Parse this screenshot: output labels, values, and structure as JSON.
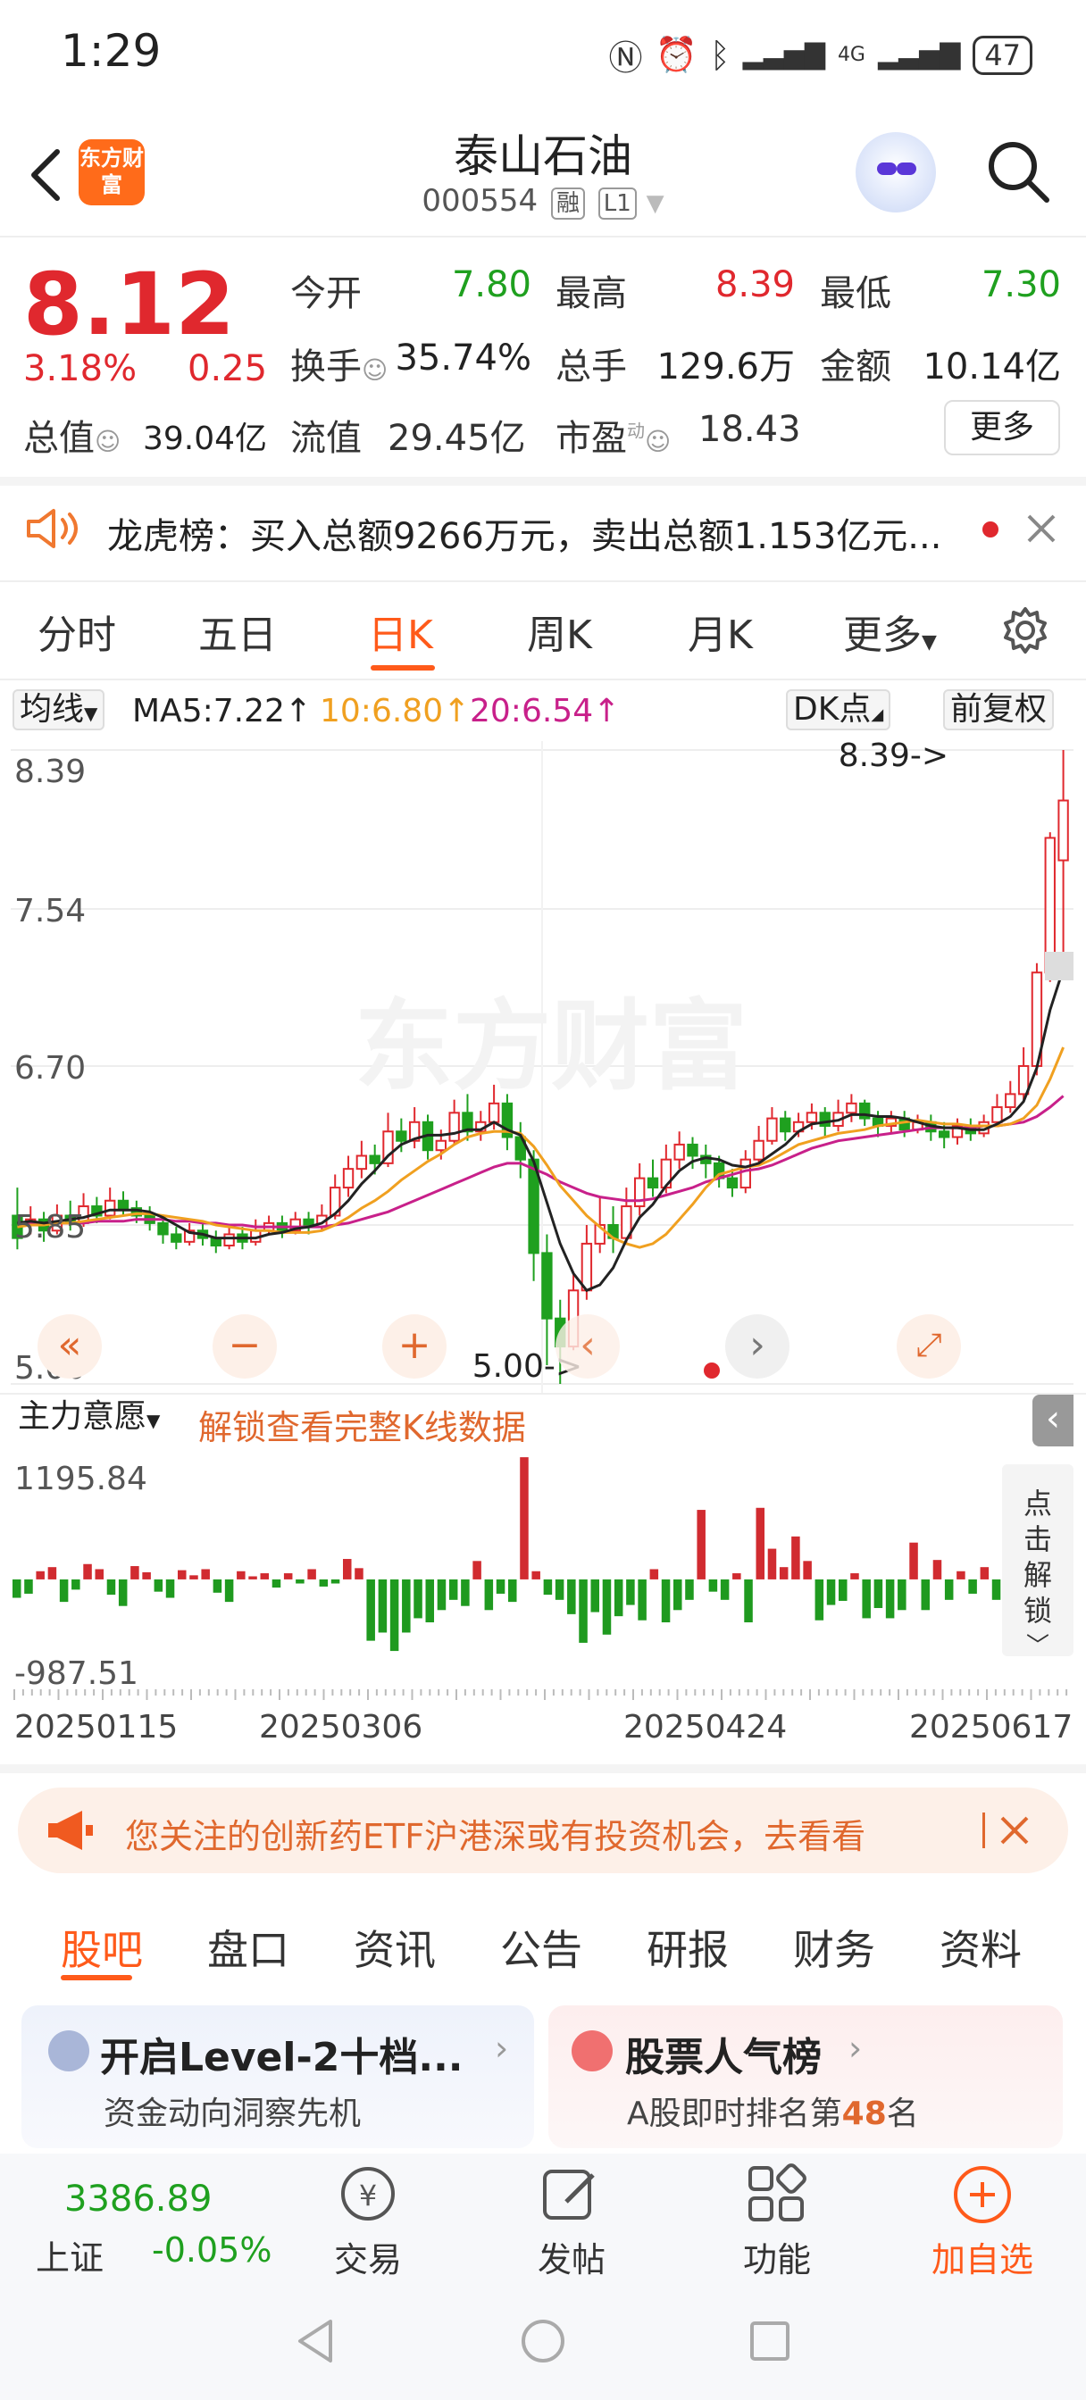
{
  "status_bar": {
    "time": "1:29",
    "network": "4G",
    "battery": "47"
  },
  "header": {
    "logo_text": "东方财富",
    "stock_name": "泰山石油",
    "stock_code": "000554",
    "tag_rong": "融",
    "tag_level": "L1"
  },
  "quote": {
    "price": "8.12",
    "change_pct": "3.18%",
    "change": "0.25",
    "rows": [
      [
        {
          "label": "今开",
          "value": "7.80",
          "color": "#1fa01f"
        },
        {
          "label": "最高",
          "value": "8.39",
          "color": "#e0282e"
        },
        {
          "label": "最低",
          "value": "7.30",
          "color": "#1fa01f"
        }
      ],
      [
        {
          "label": "换手",
          "value": "35.74%",
          "color": "#222"
        },
        {
          "label": "总手",
          "value": "129.6万",
          "color": "#222"
        },
        {
          "label": "金额",
          "value": "10.14亿",
          "color": "#222"
        }
      ]
    ],
    "row3": {
      "total_label": "总值",
      "total_value": "39.04亿",
      "float_label": "流值",
      "float_value": "29.45亿",
      "pe_label": "市盈",
      "pe_sup": "动",
      "pe_value": "18.43"
    },
    "more_label": "更多"
  },
  "notice": {
    "text": "龙虎榜：买入总额9266万元，卖出总额1.153亿元..."
  },
  "kline_tabs": [
    "分时",
    "五日",
    "日K",
    "周K",
    "月K",
    "更多"
  ],
  "kline_active": "日K",
  "ma_row": {
    "selector": "均线",
    "ma5": "MA5:7.22↑",
    "ma10": "10:6.80↑",
    "ma20": "20:6.54↑",
    "dk": "DK点",
    "adjust": "前复权"
  },
  "chart_data": {
    "type": "candlestick",
    "y_ticks": [
      "8.39",
      "7.54",
      "6.70",
      "5.85",
      "5.00"
    ],
    "ylim": [
      5.0,
      8.39
    ],
    "high_marker": "8.39->",
    "low_marker": "5.00->",
    "watermark": "东方财富",
    "candles": [
      [
        5.9,
        5.78,
        6.05,
        5.72
      ],
      [
        5.85,
        5.88,
        5.95,
        5.8
      ],
      [
        5.88,
        5.82,
        5.92,
        5.76
      ],
      [
        5.82,
        5.9,
        5.96,
        5.8
      ],
      [
        5.9,
        5.86,
        5.98,
        5.82
      ],
      [
        5.86,
        5.95,
        6.02,
        5.84
      ],
      [
        5.95,
        5.9,
        6.0,
        5.86
      ],
      [
        5.9,
        5.98,
        6.05,
        5.88
      ],
      [
        5.98,
        5.94,
        6.03,
        5.9
      ],
      [
        5.94,
        5.9,
        5.98,
        5.86
      ],
      [
        5.9,
        5.86,
        5.95,
        5.82
      ],
      [
        5.86,
        5.8,
        5.9,
        5.75
      ],
      [
        5.8,
        5.76,
        5.84,
        5.72
      ],
      [
        5.76,
        5.82,
        5.86,
        5.74
      ],
      [
        5.82,
        5.78,
        5.86,
        5.74
      ],
      [
        5.78,
        5.74,
        5.82,
        5.7
      ],
      [
        5.74,
        5.8,
        5.85,
        5.72
      ],
      [
        5.8,
        5.76,
        5.84,
        5.72
      ],
      [
        5.76,
        5.82,
        5.88,
        5.74
      ],
      [
        5.82,
        5.86,
        5.9,
        5.8
      ],
      [
        5.86,
        5.82,
        5.9,
        5.78
      ],
      [
        5.82,
        5.88,
        5.92,
        5.8
      ],
      [
        5.88,
        5.84,
        5.92,
        5.8
      ],
      [
        5.84,
        5.9,
        5.96,
        5.82
      ],
      [
        5.9,
        6.05,
        6.12,
        5.88
      ],
      [
        6.05,
        6.15,
        6.22,
        6.0
      ],
      [
        6.15,
        6.22,
        6.3,
        6.1
      ],
      [
        6.22,
        6.18,
        6.28,
        6.12
      ],
      [
        6.18,
        6.35,
        6.45,
        6.16
      ],
      [
        6.35,
        6.3,
        6.42,
        6.24
      ],
      [
        6.3,
        6.4,
        6.48,
        6.26
      ],
      [
        6.4,
        6.25,
        6.44,
        6.2
      ],
      [
        6.25,
        6.3,
        6.36,
        6.2
      ],
      [
        6.3,
        6.45,
        6.52,
        6.28
      ],
      [
        6.45,
        6.35,
        6.55,
        6.3
      ],
      [
        6.35,
        6.4,
        6.46,
        6.3
      ],
      [
        6.4,
        6.5,
        6.6,
        6.36
      ],
      [
        6.5,
        6.32,
        6.55,
        6.25
      ],
      [
        6.32,
        6.2,
        6.4,
        6.1
      ],
      [
        6.2,
        5.7,
        6.25,
        5.55
      ],
      [
        5.7,
        5.35,
        5.8,
        5.1
      ],
      [
        5.35,
        5.2,
        5.45,
        5.0
      ],
      [
        5.2,
        5.5,
        5.6,
        5.18
      ],
      [
        5.5,
        5.75,
        5.85,
        5.45
      ],
      [
        5.75,
        5.85,
        6.0,
        5.7
      ],
      [
        5.85,
        5.78,
        5.95,
        5.7
      ],
      [
        5.78,
        5.95,
        6.05,
        5.75
      ],
      [
        5.95,
        6.1,
        6.18,
        5.9
      ],
      [
        6.1,
        6.05,
        6.2,
        6.0
      ],
      [
        6.05,
        6.2,
        6.28,
        6.02
      ],
      [
        6.2,
        6.28,
        6.35,
        6.15
      ],
      [
        6.28,
        6.22,
        6.32,
        6.15
      ],
      [
        6.22,
        6.18,
        6.28,
        6.1
      ],
      [
        6.18,
        6.1,
        6.22,
        6.05
      ],
      [
        6.1,
        6.05,
        6.15,
        6.0
      ],
      [
        6.05,
        6.2,
        6.25,
        6.02
      ],
      [
        6.2,
        6.3,
        6.38,
        6.18
      ],
      [
        6.3,
        6.42,
        6.48,
        6.28
      ],
      [
        6.42,
        6.35,
        6.46,
        6.3
      ],
      [
        6.35,
        6.4,
        6.45,
        6.32
      ],
      [
        6.4,
        6.45,
        6.5,
        6.36
      ],
      [
        6.45,
        6.38,
        6.48,
        6.32
      ],
      [
        6.38,
        6.45,
        6.52,
        6.35
      ],
      [
        6.45,
        6.5,
        6.55,
        6.4
      ],
      [
        6.5,
        6.42,
        6.52,
        6.38
      ],
      [
        6.42,
        6.38,
        6.46,
        6.32
      ],
      [
        6.38,
        6.42,
        6.46,
        6.34
      ],
      [
        6.42,
        6.36,
        6.46,
        6.32
      ],
      [
        6.36,
        6.4,
        6.44,
        6.34
      ],
      [
        6.4,
        6.35,
        6.44,
        6.3
      ],
      [
        6.35,
        6.32,
        6.4,
        6.26
      ],
      [
        6.32,
        6.38,
        6.42,
        6.28
      ],
      [
        6.38,
        6.34,
        6.42,
        6.3
      ],
      [
        6.34,
        6.4,
        6.44,
        6.32
      ],
      [
        6.4,
        6.48,
        6.55,
        6.38
      ],
      [
        6.48,
        6.55,
        6.62,
        6.45
      ],
      [
        6.55,
        6.7,
        6.8,
        6.52
      ],
      [
        6.7,
        7.2,
        7.25,
        6.65
      ],
      [
        7.2,
        7.92,
        7.95,
        7.15
      ],
      [
        7.8,
        8.12,
        8.39,
        7.3
      ]
    ],
    "ma5": [
      5.86,
      5.87,
      5.86,
      5.87,
      5.88,
      5.89,
      5.91,
      5.93,
      5.93,
      5.93,
      5.92,
      5.89,
      5.85,
      5.81,
      5.8,
      5.78,
      5.78,
      5.78,
      5.78,
      5.8,
      5.81,
      5.83,
      5.84,
      5.86,
      5.91,
      5.98,
      6.07,
      6.14,
      6.22,
      6.28,
      6.31,
      6.33,
      6.33,
      6.34,
      6.36,
      6.36,
      6.4,
      6.36,
      6.33,
      6.19,
      5.97,
      5.75,
      5.59,
      5.5,
      5.53,
      5.62,
      5.77,
      5.89,
      5.96,
      6.06,
      6.14,
      6.19,
      6.21,
      6.2,
      6.17,
      6.16,
      6.18,
      6.23,
      6.28,
      6.35,
      6.39,
      6.4,
      6.41,
      6.44,
      6.44,
      6.43,
      6.43,
      6.42,
      6.4,
      6.38,
      6.37,
      6.37,
      6.36,
      6.36,
      6.39,
      6.43,
      6.51,
      6.69,
      7.0,
      7.22
    ],
    "ma10": [
      5.84,
      5.85,
      5.85,
      5.86,
      5.86,
      5.87,
      5.88,
      5.89,
      5.9,
      5.91,
      5.91,
      5.9,
      5.89,
      5.88,
      5.87,
      5.85,
      5.84,
      5.83,
      5.82,
      5.82,
      5.81,
      5.81,
      5.81,
      5.82,
      5.85,
      5.89,
      5.94,
      5.98,
      6.03,
      6.09,
      6.14,
      6.19,
      6.23,
      6.28,
      6.32,
      6.34,
      6.35,
      6.35,
      6.34,
      6.27,
      6.17,
      6.06,
      5.98,
      5.9,
      5.84,
      5.78,
      5.75,
      5.73,
      5.75,
      5.8,
      5.88,
      5.96,
      6.05,
      6.12,
      6.14,
      6.16,
      6.17,
      6.2,
      6.24,
      6.28,
      6.3,
      6.32,
      6.34,
      6.35,
      6.36,
      6.38,
      6.39,
      6.4,
      6.41,
      6.4,
      6.39,
      6.39,
      6.38,
      6.38,
      6.38,
      6.39,
      6.42,
      6.49,
      6.63,
      6.8
    ],
    "ma20": [
      5.86,
      5.86,
      5.86,
      5.86,
      5.86,
      5.86,
      5.87,
      5.87,
      5.87,
      5.88,
      5.88,
      5.88,
      5.87,
      5.87,
      5.86,
      5.86,
      5.85,
      5.85,
      5.84,
      5.84,
      5.84,
      5.84,
      5.84,
      5.84,
      5.85,
      5.86,
      5.88,
      5.9,
      5.92,
      5.95,
      5.98,
      6.01,
      6.04,
      6.07,
      6.1,
      6.13,
      6.16,
      6.18,
      6.18,
      6.15,
      6.12,
      6.08,
      6.05,
      6.02,
      6.0,
      5.99,
      5.98,
      5.98,
      5.99,
      6.01,
      6.03,
      6.05,
      6.08,
      6.1,
      6.12,
      6.14,
      6.15,
      6.17,
      6.2,
      6.23,
      6.26,
      6.28,
      6.3,
      6.31,
      6.32,
      6.33,
      6.34,
      6.35,
      6.36,
      6.37,
      6.37,
      6.37,
      6.37,
      6.38,
      6.38,
      6.39,
      6.4,
      6.43,
      6.48,
      6.54
    ]
  },
  "indicator": {
    "selector": "主力意愿",
    "unlock_text": "解锁查看完整K线数据",
    "max_label": "1195.84",
    "min_label": "-987.51",
    "side_unlock": "点击解锁",
    "bars": [
      -180,
      -140,
      80,
      120,
      -220,
      -100,
      150,
      100,
      -150,
      -260,
      130,
      70,
      -120,
      -180,
      90,
      40,
      100,
      -130,
      -220,
      80,
      30,
      60,
      -80,
      60,
      -40,
      100,
      -70,
      -40,
      200,
      110,
      -600,
      -520,
      -700,
      -520,
      -380,
      -420,
      -300,
      -200,
      -260,
      180,
      -300,
      -140,
      -220,
      1195,
      80,
      -150,
      -200,
      -340,
      -620,
      -320,
      -540,
      -360,
      -250,
      -400,
      100,
      -420,
      -300,
      -200,
      680,
      -120,
      -200,
      60,
      -420,
      700,
      300,
      120,
      420,
      180,
      -400,
      -250,
      -210,
      60,
      -380,
      -280,
      -380,
      -300,
      360,
      -300,
      190,
      -200,
      80,
      -140,
      120,
      -200
    ]
  },
  "date_axis": [
    "20250115",
    "20250306",
    "20250424",
    "20250617"
  ],
  "ad_banner": {
    "text": "您关注的创新药ETF沪港深或有投资机会，去看看"
  },
  "bottom_tabs": [
    "股吧",
    "盘口",
    "资讯",
    "公告",
    "研报",
    "财务",
    "资料"
  ],
  "cards": [
    {
      "title": "开启Level-2十档...",
      "subtitle": "资金动向洞察先机"
    },
    {
      "title": "股票人气榜",
      "subtitle_prefix": "A股即时排名第",
      "rank": "48",
      "subtitle_suffix": "名"
    }
  ],
  "bottom_nav": {
    "index_value": "3386.89",
    "index_name": "上证",
    "index_change": "-0.05%",
    "items": [
      "交易",
      "发帖",
      "功能",
      "加自选"
    ]
  }
}
